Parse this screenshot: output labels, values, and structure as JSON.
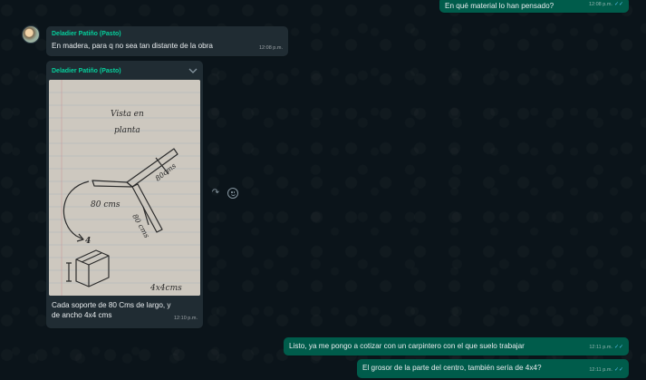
{
  "messages": {
    "top_outgoing": {
      "text": "En qué material lo han pensado?",
      "time": "12:08 p.m.",
      "ticks": "✓✓"
    },
    "incoming_1": {
      "sender": "Deladier Patiño (Pasto)",
      "text": "En madera, para q no sea tan distante de la obra",
      "time": "12:08 p.m."
    },
    "incoming_image": {
      "sender": "Deladier Patiño (Pasto)",
      "caption_line1": "Cada soporte de 80 Cms de largo, y",
      "caption_line2": "de ancho 4x4 cms",
      "time": "12:10 p.m.",
      "sketch_text": {
        "title_line1": "Vista en",
        "title_line2": "planta",
        "arm1": "80 cms",
        "arm2": "80cms",
        "arm3": "80 cms",
        "marker": "4",
        "dimension": "4x4cms"
      }
    },
    "outgoing_2": {
      "text": "Listo, ya me pongo a cotizar con un carpintero con el que suelo trabajar",
      "time": "12:11 p.m.",
      "ticks": "✓✓"
    },
    "outgoing_3": {
      "text": "El grosor de la parte del centro, también sería de 4x4?",
      "time": "12:11 p.m.",
      "ticks": "✓✓"
    }
  },
  "icons": {
    "forward": "forward-icon",
    "react": "emoji-react-icon",
    "chevron": "chevron-down-icon"
  },
  "colors": {
    "outgoing_bubble": "#005c4b",
    "incoming_bubble": "#202c33",
    "sender_name": "#06cf9c",
    "wallpaper": "#0b141a",
    "read_ticks": "#53bdeb"
  }
}
